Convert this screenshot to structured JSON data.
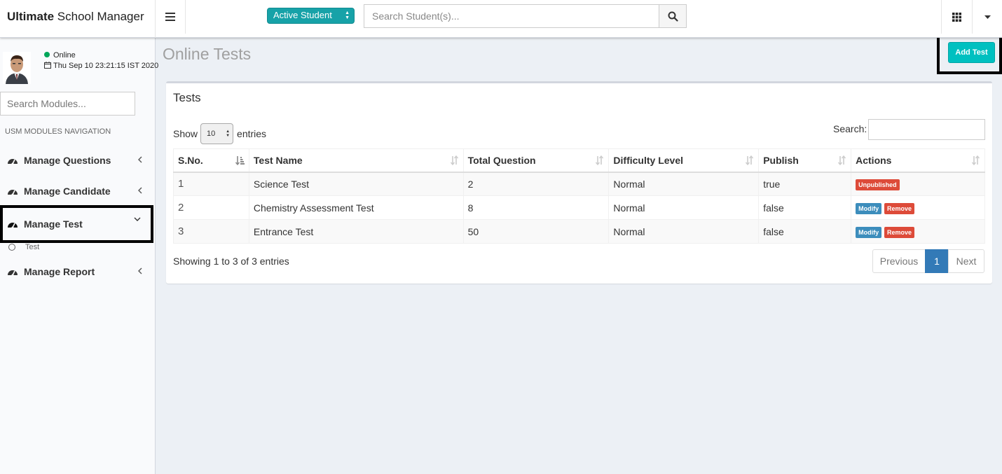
{
  "app": {
    "logo_bold": "Ultimate",
    "logo_rest": " School Manager"
  },
  "header": {
    "student_select_value": "Active Student",
    "search_placeholder": "Search Student(s)..."
  },
  "user": {
    "status": "Online",
    "datetime": "Thu Sep 10 23:21:15 IST 2020"
  },
  "sidebar": {
    "search_placeholder": "Search Modules...",
    "nav_header": "USM MODULES NAVIGATION",
    "items": [
      {
        "label": "Manage Questions"
      },
      {
        "label": "Manage Candidate"
      },
      {
        "label": "Manage Test"
      },
      {
        "label": "Manage Report"
      }
    ],
    "sub_item": "Test"
  },
  "page": {
    "title": "Online Tests",
    "add_button": "Add Test"
  },
  "box": {
    "title": "Tests",
    "show_label": "Show",
    "entries_value": "10",
    "entries_label": "entries",
    "search_label": "Search:",
    "columns": [
      "S.No.",
      "Test Name",
      "Total Question",
      "Difficulty Level",
      "Publish",
      "Actions"
    ],
    "rows": [
      {
        "sno": "1",
        "name": "Science Test",
        "total": "2",
        "difficulty": "Normal",
        "publish": "true"
      },
      {
        "sno": "2",
        "name": "Chemistry Assessment Test",
        "total": "8",
        "difficulty": "Normal",
        "publish": "false"
      },
      {
        "sno": "3",
        "name": "Entrance Test",
        "total": "50",
        "difficulty": "Normal",
        "publish": "false"
      }
    ],
    "actions": {
      "unpublished": "Unpublished",
      "modify": "Modify",
      "remove": "Remove"
    },
    "info": "Showing 1 to 3 of 3 entries",
    "pagination": {
      "previous": "Previous",
      "current": "1",
      "next": "Next"
    }
  },
  "colors": {
    "accent": "#00c0c0",
    "active_student_bg": "#17a2a8",
    "danger": "#dd4b39",
    "primary": "#3c8dbc",
    "page_active": "#337ab7"
  }
}
